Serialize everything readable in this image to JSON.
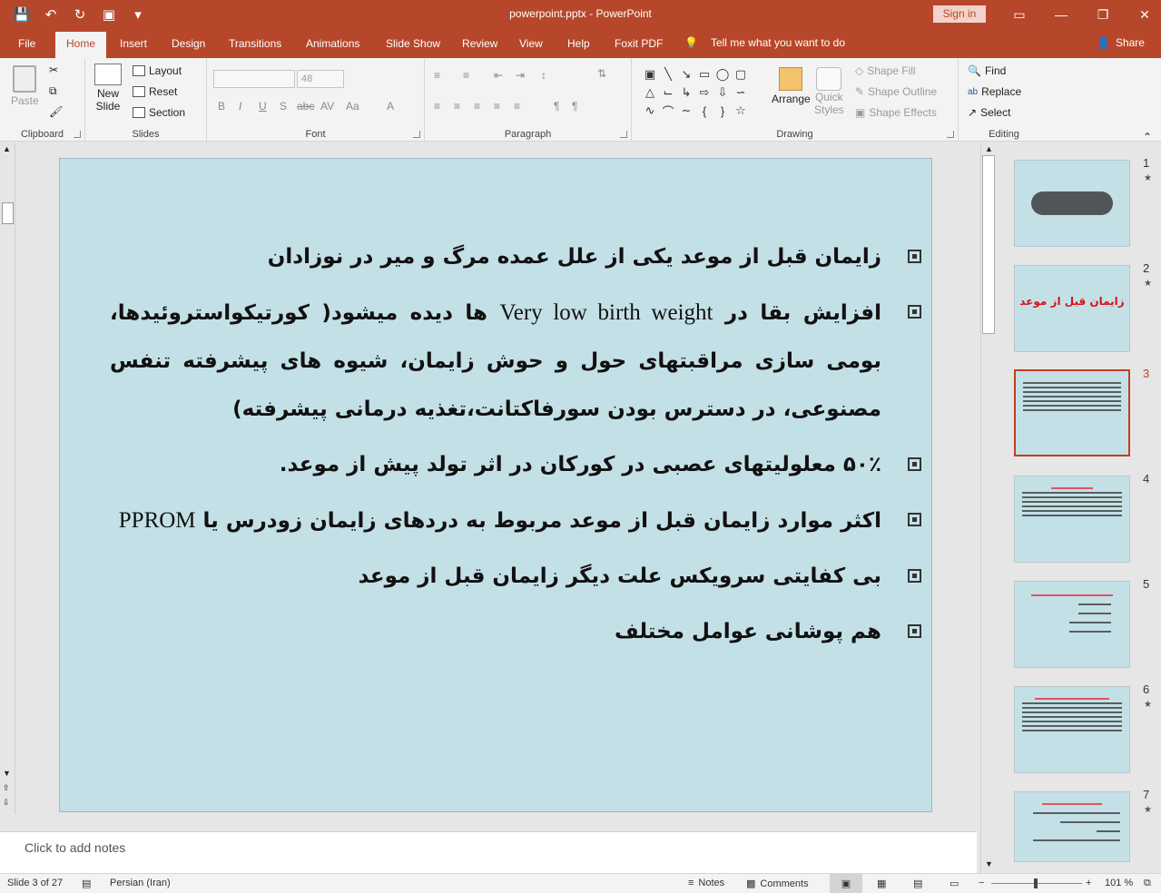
{
  "window": {
    "title": "powerpoint.pptx  -  PowerPoint",
    "sign_in": "Sign in"
  },
  "tabs": [
    "File",
    "Home",
    "Insert",
    "Design",
    "Transitions",
    "Animations",
    "Slide Show",
    "Review",
    "View",
    "Help",
    "Foxit PDF"
  ],
  "active_tab": "Home",
  "tell_me": "Tell me what you want to do",
  "share": "Share",
  "ribbon": {
    "clipboard": {
      "paste": "Paste",
      "label": "Clipboard"
    },
    "slides": {
      "new_slide_line1": "New",
      "new_slide_line2": "Slide",
      "layout": "Layout",
      "reset": "Reset",
      "section": "Section",
      "label": "Slides"
    },
    "font": {
      "size": "48",
      "label": "Font"
    },
    "paragraph": {
      "label": "Paragraph"
    },
    "drawing": {
      "arrange": "Arrange",
      "quick_styles_line1": "Quick",
      "quick_styles_line2": "Styles",
      "shape_fill": "Shape Fill",
      "shape_outline": "Shape Outline",
      "shape_effects": "Shape Effects",
      "label": "Drawing"
    },
    "editing": {
      "find": "Find",
      "replace": "Replace",
      "select": "Select",
      "label": "Editing"
    }
  },
  "slide": {
    "bullets": [
      "زایمان قبل از موعد یکی از علل عمده مرگ و میر در نوزادان",
      {
        "before": "افزایش بقا در ",
        "latin": "Very low birth weight",
        "after": " ها دیده میشود( کورتیکواستروئیدها، بومی سازی مراقبتهای حول و حوش زایمان، شیوه های پیشرفته تنفس مصنوعی، در دسترس بودن سورفاکتانت،تغذیه درمانی پیشرفته)"
      },
      "۵۰٪ معلولیتهای عصبی در کورکان در اثر تولد پیش از موعد.",
      {
        "before": "اکثر موارد زایمان قبل از موعد مربوط به دردهای زایمان زودرس یا ",
        "latin": "PPROM",
        "after": ""
      },
      "بی کفایتی سرویکس علت دیگر زایمان قبل از موعد",
      "هم پوشانی عوامل مختلف"
    ]
  },
  "thumbnails": [
    {
      "number": "1",
      "star": true
    },
    {
      "number": "2",
      "star": true,
      "title": "زایمان قبل از موعد"
    },
    {
      "number": "3",
      "star": false,
      "selected": true
    },
    {
      "number": "4",
      "star": false
    },
    {
      "number": "5",
      "star": false
    },
    {
      "number": "6",
      "star": true
    },
    {
      "number": "7",
      "star": true
    }
  ],
  "notes_placeholder": "Click to add notes",
  "status": {
    "slide_info": "Slide 3 of 27",
    "language": "Persian (Iran)",
    "notes": "Notes",
    "comments": "Comments",
    "zoom": "101 %"
  }
}
